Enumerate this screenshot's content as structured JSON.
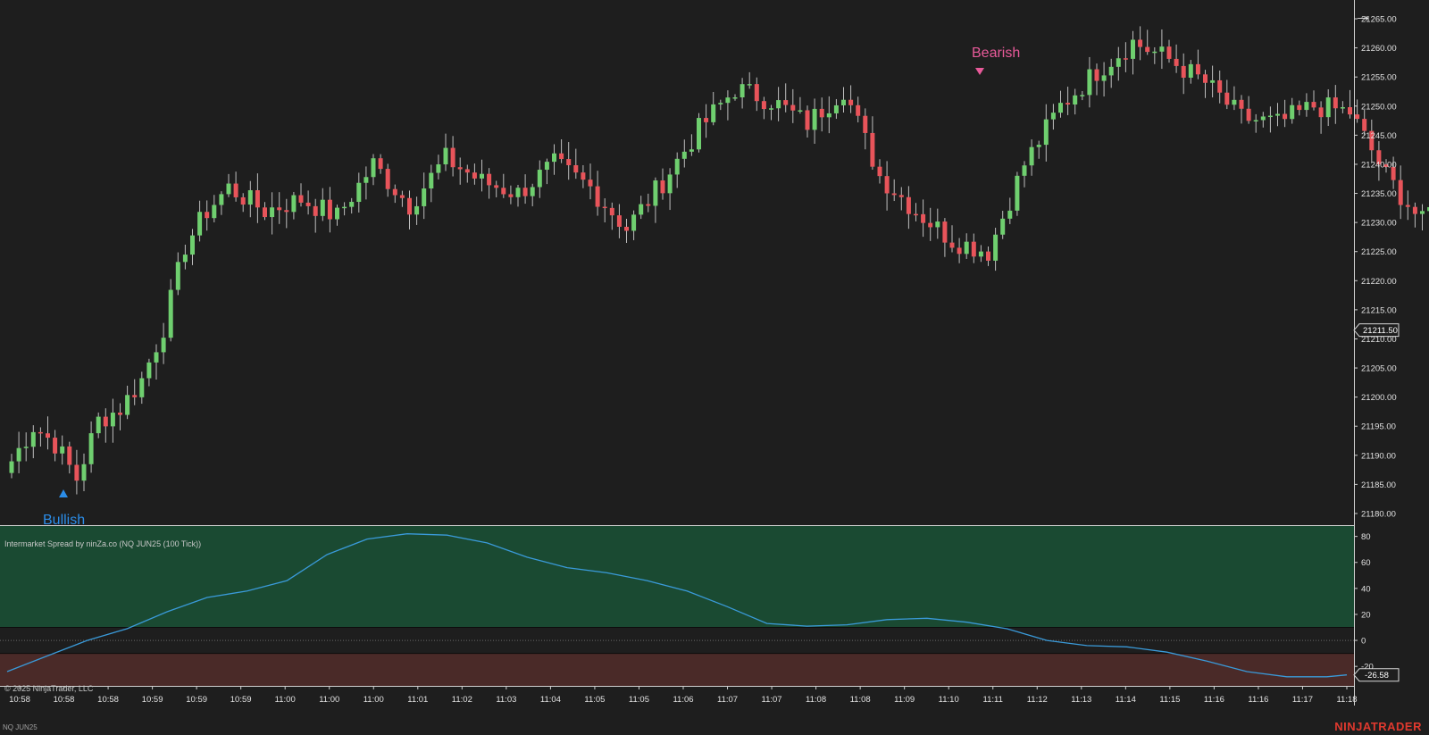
{
  "instrument": "NQ JUN25",
  "brand": "NINJATRADER",
  "copyright": "© 2025 NinjaTrader, LLC",
  "indicator_title": "Intermarket Spread by ninZa.co (NQ JUN25 (100 Tick))",
  "signals": {
    "bullish": "Bullish",
    "bearish": "Bearish"
  },
  "colors": {
    "background": "#1e1e1e",
    "up_candle": "#6fcf6f",
    "down_candle": "#e8545a",
    "upper_zone": "#1a4a32",
    "lower_zone": "#4a2a28",
    "spread_line": "#3a9ad9",
    "bullish": "#2b8de8",
    "bearish": "#e85a9a"
  },
  "icons": {
    "navigate": "right-arrow-icon"
  },
  "price_axis": {
    "ticks": [
      "21265.00",
      "21260.00",
      "21255.00",
      "21250.00",
      "21245.00",
      "21240.00",
      "21235.00",
      "21230.00",
      "21225.00",
      "21220.00",
      "21215.00",
      "21210.00",
      "21205.00",
      "21200.00",
      "21195.00",
      "21190.00",
      "21185.00",
      "21180.00"
    ],
    "current_price": "21211.50"
  },
  "indicator_axis": {
    "ticks": [
      "80",
      "60",
      "40",
      "20",
      "0",
      "-20"
    ],
    "current_value": "-26.58"
  },
  "time_axis": [
    "10:58",
    "10:58",
    "10:58",
    "10:59",
    "10:59",
    "10:59",
    "11:00",
    "11:00",
    "11:00",
    "11:01",
    "11:02",
    "11:03",
    "11:04",
    "11:05",
    "11:05",
    "11:06",
    "11:07",
    "11:07",
    "11:08",
    "11:08",
    "11:09",
    "11:10",
    "11:11",
    "11:12",
    "11:13",
    "11:14",
    "11:15",
    "11:16",
    "11:16",
    "11:17",
    "11:18"
  ],
  "chart_data": [
    {
      "type": "candlestick",
      "ylim": [
        21178,
        21267
      ],
      "close_path": [
        [
          0,
          21189
        ],
        [
          3,
          21195
        ],
        [
          6,
          21192
        ],
        [
          9,
          21186
        ],
        [
          12,
          21196
        ],
        [
          15,
          21198
        ],
        [
          18,
          21203
        ],
        [
          21,
          21212
        ],
        [
          24,
          21226
        ],
        [
          27,
          21232
        ],
        [
          30,
          21236
        ],
        [
          35,
          21232
        ],
        [
          40,
          21234
        ],
        [
          45,
          21231
        ],
        [
          50,
          21240
        ],
        [
          55,
          21233
        ],
        [
          60,
          21241
        ],
        [
          65,
          21237
        ],
        [
          70,
          21235
        ],
        [
          75,
          21240
        ],
        [
          80,
          21236
        ],
        [
          85,
          21229
        ],
        [
          90,
          21237
        ],
        [
          95,
          21246
        ],
        [
          100,
          21253
        ],
        [
          105,
          21251
        ],
        [
          110,
          21247
        ],
        [
          115,
          21253
        ],
        [
          120,
          21238
        ],
        [
          125,
          21232
        ],
        [
          130,
          21227
        ],
        [
          135,
          21225
        ],
        [
          140,
          21240
        ],
        [
          145,
          21250
        ],
        [
          150,
          21256
        ],
        [
          155,
          21261
        ],
        [
          160,
          21258
        ],
        [
          165,
          21254
        ],
        [
          170,
          21248
        ],
        [
          175,
          21247
        ],
        [
          180,
          21250
        ],
        [
          185,
          21249
        ],
        [
          190,
          21238
        ],
        [
          195,
          21230
        ],
        [
          200,
          21240
        ],
        [
          205,
          21246
        ],
        [
          210,
          21238
        ],
        [
          215,
          21240
        ],
        [
          220,
          21231
        ],
        [
          225,
          21226
        ],
        [
          230,
          21220
        ],
        [
          235,
          21223
        ],
        [
          240,
          21214
        ],
        [
          245,
          21210
        ],
        [
          250,
          21211
        ],
        [
          255,
          21214
        ],
        [
          260,
          21211
        ],
        [
          265,
          21212
        ]
      ],
      "signals": [
        {
          "label": "Bullish",
          "bar": 8
        },
        {
          "label": "Bearish",
          "bar": 177
        }
      ]
    },
    {
      "type": "line",
      "ylim": [
        -35,
        88
      ],
      "upper_zone": [
        10,
        88
      ],
      "lower_zone": [
        -35,
        -10
      ],
      "series": [
        {
          "points": [
            [
              0,
              -24
            ],
            [
              20,
              -12
            ],
            [
              40,
              0
            ],
            [
              60,
              9
            ],
            [
              80,
              22
            ],
            [
              100,
              33
            ],
            [
              120,
              38
            ],
            [
              140,
              46
            ],
            [
              160,
              66
            ],
            [
              180,
              78
            ],
            [
              200,
              82
            ],
            [
              220,
              81
            ],
            [
              240,
              75
            ],
            [
              260,
              64
            ],
            [
              280,
              56
            ],
            [
              300,
              52
            ],
            [
              320,
              46
            ],
            [
              340,
              38
            ],
            [
              360,
              26
            ],
            [
              380,
              13
            ],
            [
              400,
              11
            ],
            [
              420,
              12
            ],
            [
              440,
              16
            ],
            [
              460,
              17
            ],
            [
              480,
              14
            ],
            [
              500,
              9
            ],
            [
              520,
              0
            ],
            [
              540,
              -4
            ],
            [
              560,
              -5
            ],
            [
              580,
              -9
            ],
            [
              600,
              -16
            ],
            [
              620,
              -24
            ],
            [
              640,
              -28
            ],
            [
              660,
              -28
            ],
            [
              670,
              -26.58
            ]
          ]
        }
      ]
    }
  ]
}
